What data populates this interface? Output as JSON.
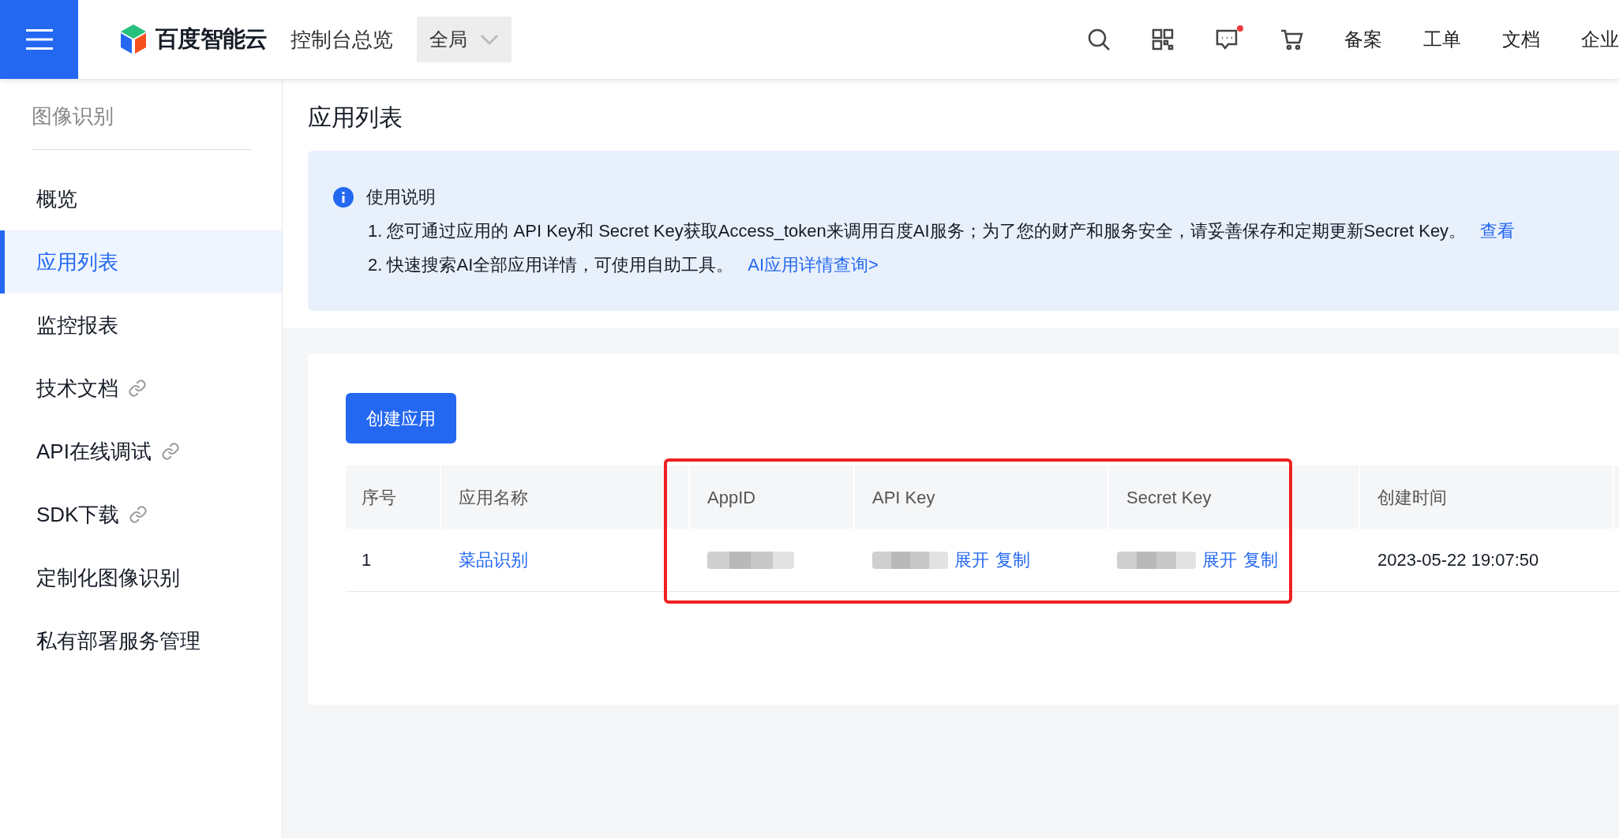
{
  "topbar": {
    "brand": "百度智能云",
    "console_title": "控制台总览",
    "region": "全局",
    "has_message_dot": true,
    "links": [
      "备案",
      "工单",
      "文档",
      "企业"
    ]
  },
  "sidebar": {
    "title": "图像识别",
    "items": [
      {
        "label": "概览",
        "selected": false,
        "external": false
      },
      {
        "label": "应用列表",
        "selected": true,
        "external": false
      },
      {
        "label": "监控报表",
        "selected": false,
        "external": false
      },
      {
        "label": "技术文档",
        "selected": false,
        "external": true
      },
      {
        "label": "API在线调试",
        "selected": false,
        "external": true
      },
      {
        "label": "SDK下载",
        "selected": false,
        "external": true
      },
      {
        "label": "定制化图像识别",
        "selected": false,
        "external": false
      },
      {
        "label": "私有部署服务管理",
        "selected": false,
        "external": false
      }
    ]
  },
  "page_title": "应用列表",
  "notice": {
    "title": "使用说明",
    "lines": [
      {
        "text": "1. 您可通过应用的 API Key和 Secret Key获取Access_token来调用百度AI服务；为了您的财产和服务安全，请妥善保存和定期更新Secret Key。",
        "link": "查看"
      },
      {
        "text": "2. 快速搜索AI全部应用详情，可使用自助工具。",
        "link": "AI应用详情查询>"
      }
    ]
  },
  "create_button": "创建应用",
  "table": {
    "columns": [
      "序号",
      "应用名称",
      "AppID",
      "API Key",
      "Secret Key",
      "创建时间"
    ],
    "rows": [
      {
        "index": "1",
        "name": "菜品识别",
        "api_key_actions": [
          "展开",
          "复制"
        ],
        "secret_key_actions": [
          "展开",
          "复制"
        ],
        "created": "2023-05-22 19:07:50"
      }
    ]
  }
}
